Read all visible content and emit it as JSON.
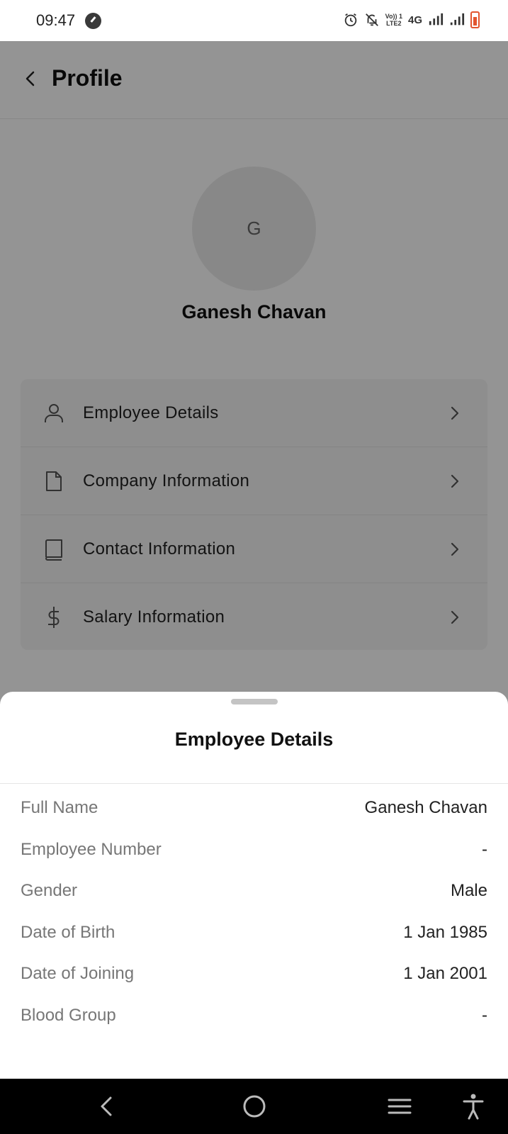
{
  "status_bar": {
    "time": "09:47",
    "network_label": "4G",
    "volte_label": "Vo)) 1\nLTE2",
    "icons": [
      "alarm-icon",
      "bell-off-icon",
      "volte-icon",
      "signal-icon",
      "signal-icon",
      "battery-icon"
    ],
    "battery_color": "#e2552f"
  },
  "header": {
    "title": "Profile"
  },
  "profile": {
    "avatar_initial": "G",
    "name": "Ganesh Chavan"
  },
  "menu": {
    "items": [
      {
        "label": "Employee Details",
        "icon": "user-icon"
      },
      {
        "label": "Company Information",
        "icon": "document-icon"
      },
      {
        "label": "Contact Information",
        "icon": "book-icon"
      },
      {
        "label": "Salary Information",
        "icon": "dollar-icon"
      }
    ]
  },
  "sheet": {
    "title": "Employee Details",
    "rows": [
      {
        "label": "Full Name",
        "value": "Ganesh Chavan"
      },
      {
        "label": "Employee Number",
        "value": "-"
      },
      {
        "label": "Gender",
        "value": "Male"
      },
      {
        "label": "Date of Birth",
        "value": "1 Jan 1985"
      },
      {
        "label": "Date of Joining",
        "value": "1 Jan 2001"
      },
      {
        "label": "Blood Group",
        "value": "-"
      }
    ]
  },
  "nav_bar": {
    "buttons": [
      "back-icon",
      "home-icon",
      "recents-icon",
      "accessibility-icon"
    ]
  }
}
